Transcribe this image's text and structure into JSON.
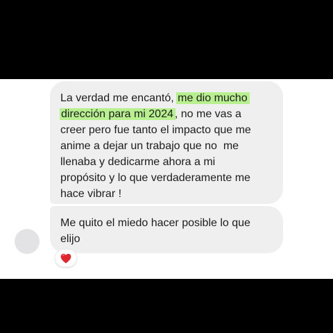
{
  "messages": [
    {
      "lines": [
        [
          {
            "text": "La verdad me encantó, ",
            "highlight": false
          },
          {
            "text": "me dio mucho",
            "highlight": true
          }
        ],
        [
          {
            "text": "dirección para mi 2024",
            "highlight": true
          },
          {
            "text": ", no me vas a",
            "highlight": false
          }
        ],
        [
          {
            "text": "creer pero fue tanto el impacto que me",
            "highlight": false
          }
        ],
        [
          {
            "text": "anime a dejar un trabajo que no  me",
            "highlight": false
          }
        ],
        [
          {
            "text": "llenaba y dedicarme ahora a mi",
            "highlight": false
          }
        ],
        [
          {
            "text": "propósito y lo que verdaderamente me",
            "highlight": false
          }
        ],
        [
          {
            "text": "hace vibrar !",
            "highlight": false
          }
        ]
      ]
    },
    {
      "lines": [
        [
          {
            "text": "Me quito el miedo hacer posible lo que",
            "highlight": false
          }
        ],
        [
          {
            "text": "elijo",
            "highlight": false
          }
        ]
      ]
    }
  ],
  "reaction": {
    "icon": "red-heart-icon",
    "color": "#e2262f"
  },
  "colors": {
    "bubble_background": "#efeff0",
    "highlight": "#b8f090",
    "text": "#1c1c1c",
    "avatar_placeholder": "#e3e3e5",
    "frame": "#000000"
  }
}
